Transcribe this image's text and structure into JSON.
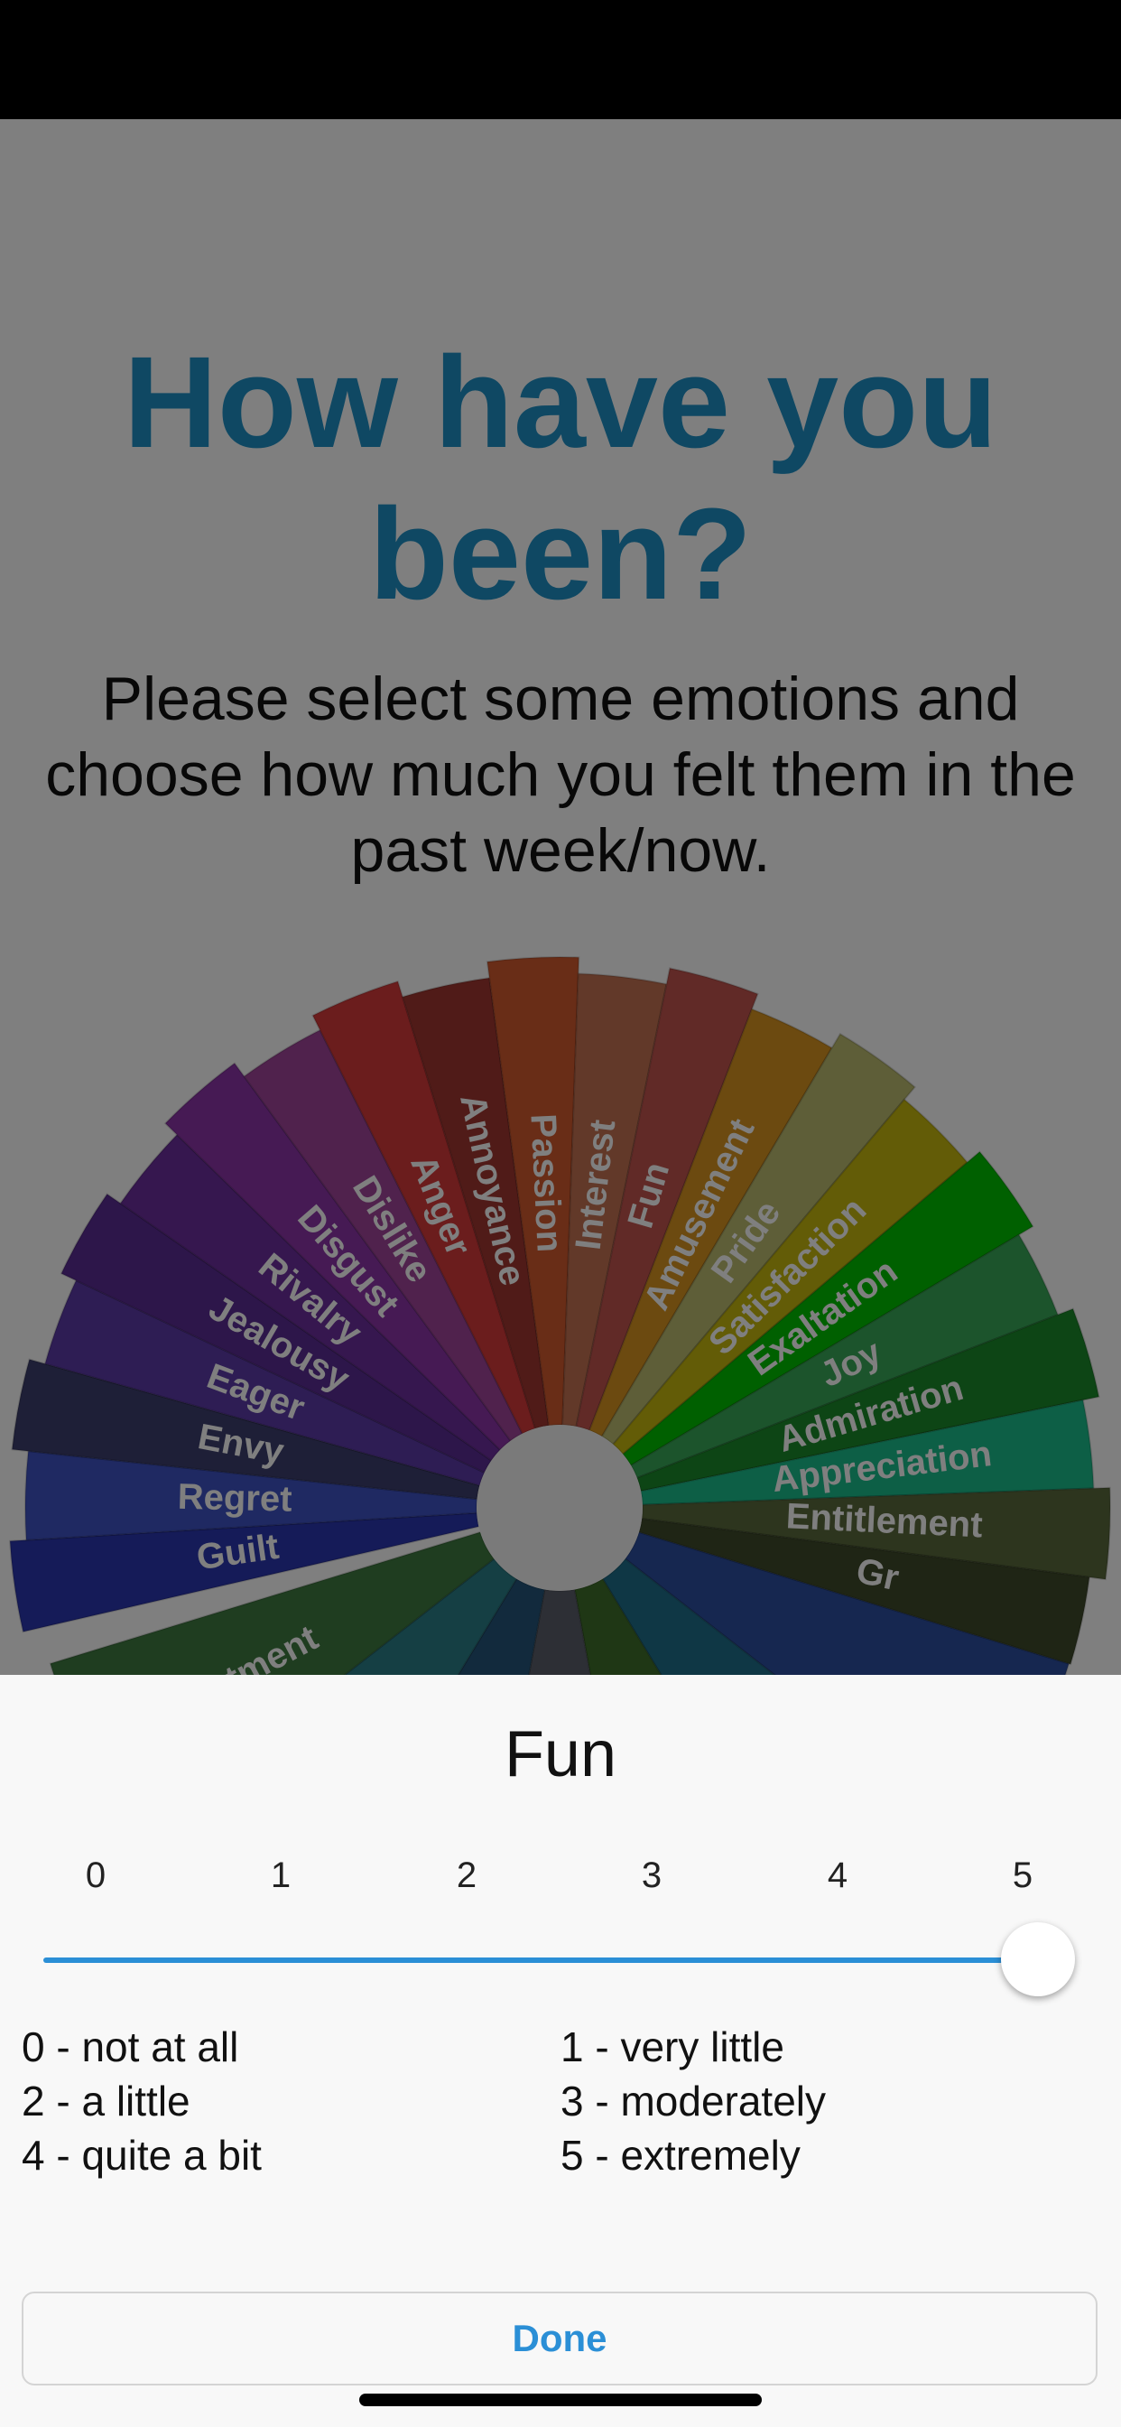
{
  "header": {
    "title": "How have you been?",
    "subtitle": "Please select some emotions and choose how much you felt them in the past week/now."
  },
  "wheel": {
    "segments": [
      {
        "label": "Guilt",
        "color": "#2b36b0"
      },
      {
        "label": "Regret",
        "color": "#3f52c4"
      },
      {
        "label": "Envy",
        "color": "#3c3e6e"
      },
      {
        "label": "Eager",
        "color": "#5c3aa8"
      },
      {
        "label": "Jealousy",
        "color": "#5b2c95"
      },
      {
        "label": "Rivalry",
        "color": "#6c2f9e"
      },
      {
        "label": "Disgust",
        "color": "#8c35a8"
      },
      {
        "label": "Dislike",
        "color": "#a0459b"
      },
      {
        "label": "Anger",
        "color": "#d63a3a"
      },
      {
        "label": "Annoyance",
        "color": "#a03730"
      },
      {
        "label": "Passion",
        "color": "#d35a2e"
      },
      {
        "label": "Interest",
        "color": "#c47252"
      },
      {
        "label": "Fun",
        "color": "#c2554e"
      },
      {
        "label": "Amusement",
        "color": "#d99520"
      },
      {
        "label": "Pride",
        "color": "#bcbc70"
      },
      {
        "label": "Satisfaction",
        "color": "#c7b80e"
      },
      {
        "label": "Exaltation",
        "color": "#00c000"
      },
      {
        "label": "Joy",
        "color": "#38a958"
      },
      {
        "label": "Admiration",
        "color": "#1b8a2a"
      },
      {
        "label": "Appreciation",
        "color": "#1bbf8c"
      },
      {
        "label": "Entitlement",
        "color": "#5a6b3c"
      },
      {
        "label": "Gr",
        "color": "#3e4a2a"
      }
    ],
    "extra_colors": [
      "#2c4fa0",
      "#1e6e8a",
      "#3e6e2a",
      "#5a5e6a",
      "#24557a",
      "#2a7e88",
      "#3e7a40"
    ],
    "partial_label": "tment",
    "hub_color": "#f5f5f5"
  },
  "sheet": {
    "title": "Fun",
    "ticks": [
      "0",
      "1",
      "2",
      "3",
      "4",
      "5"
    ],
    "slider": {
      "min": 0,
      "max": 5,
      "value": 5
    },
    "legend_left": [
      "0 - not at all",
      "2 - a little",
      "4 - quite a bit"
    ],
    "legend_right": [
      "1 - very little",
      "3 - moderately",
      "5 - extremely"
    ],
    "done_label": "Done"
  },
  "colors": {
    "accent": "#2b8fd6",
    "title": "#1f91c6"
  }
}
